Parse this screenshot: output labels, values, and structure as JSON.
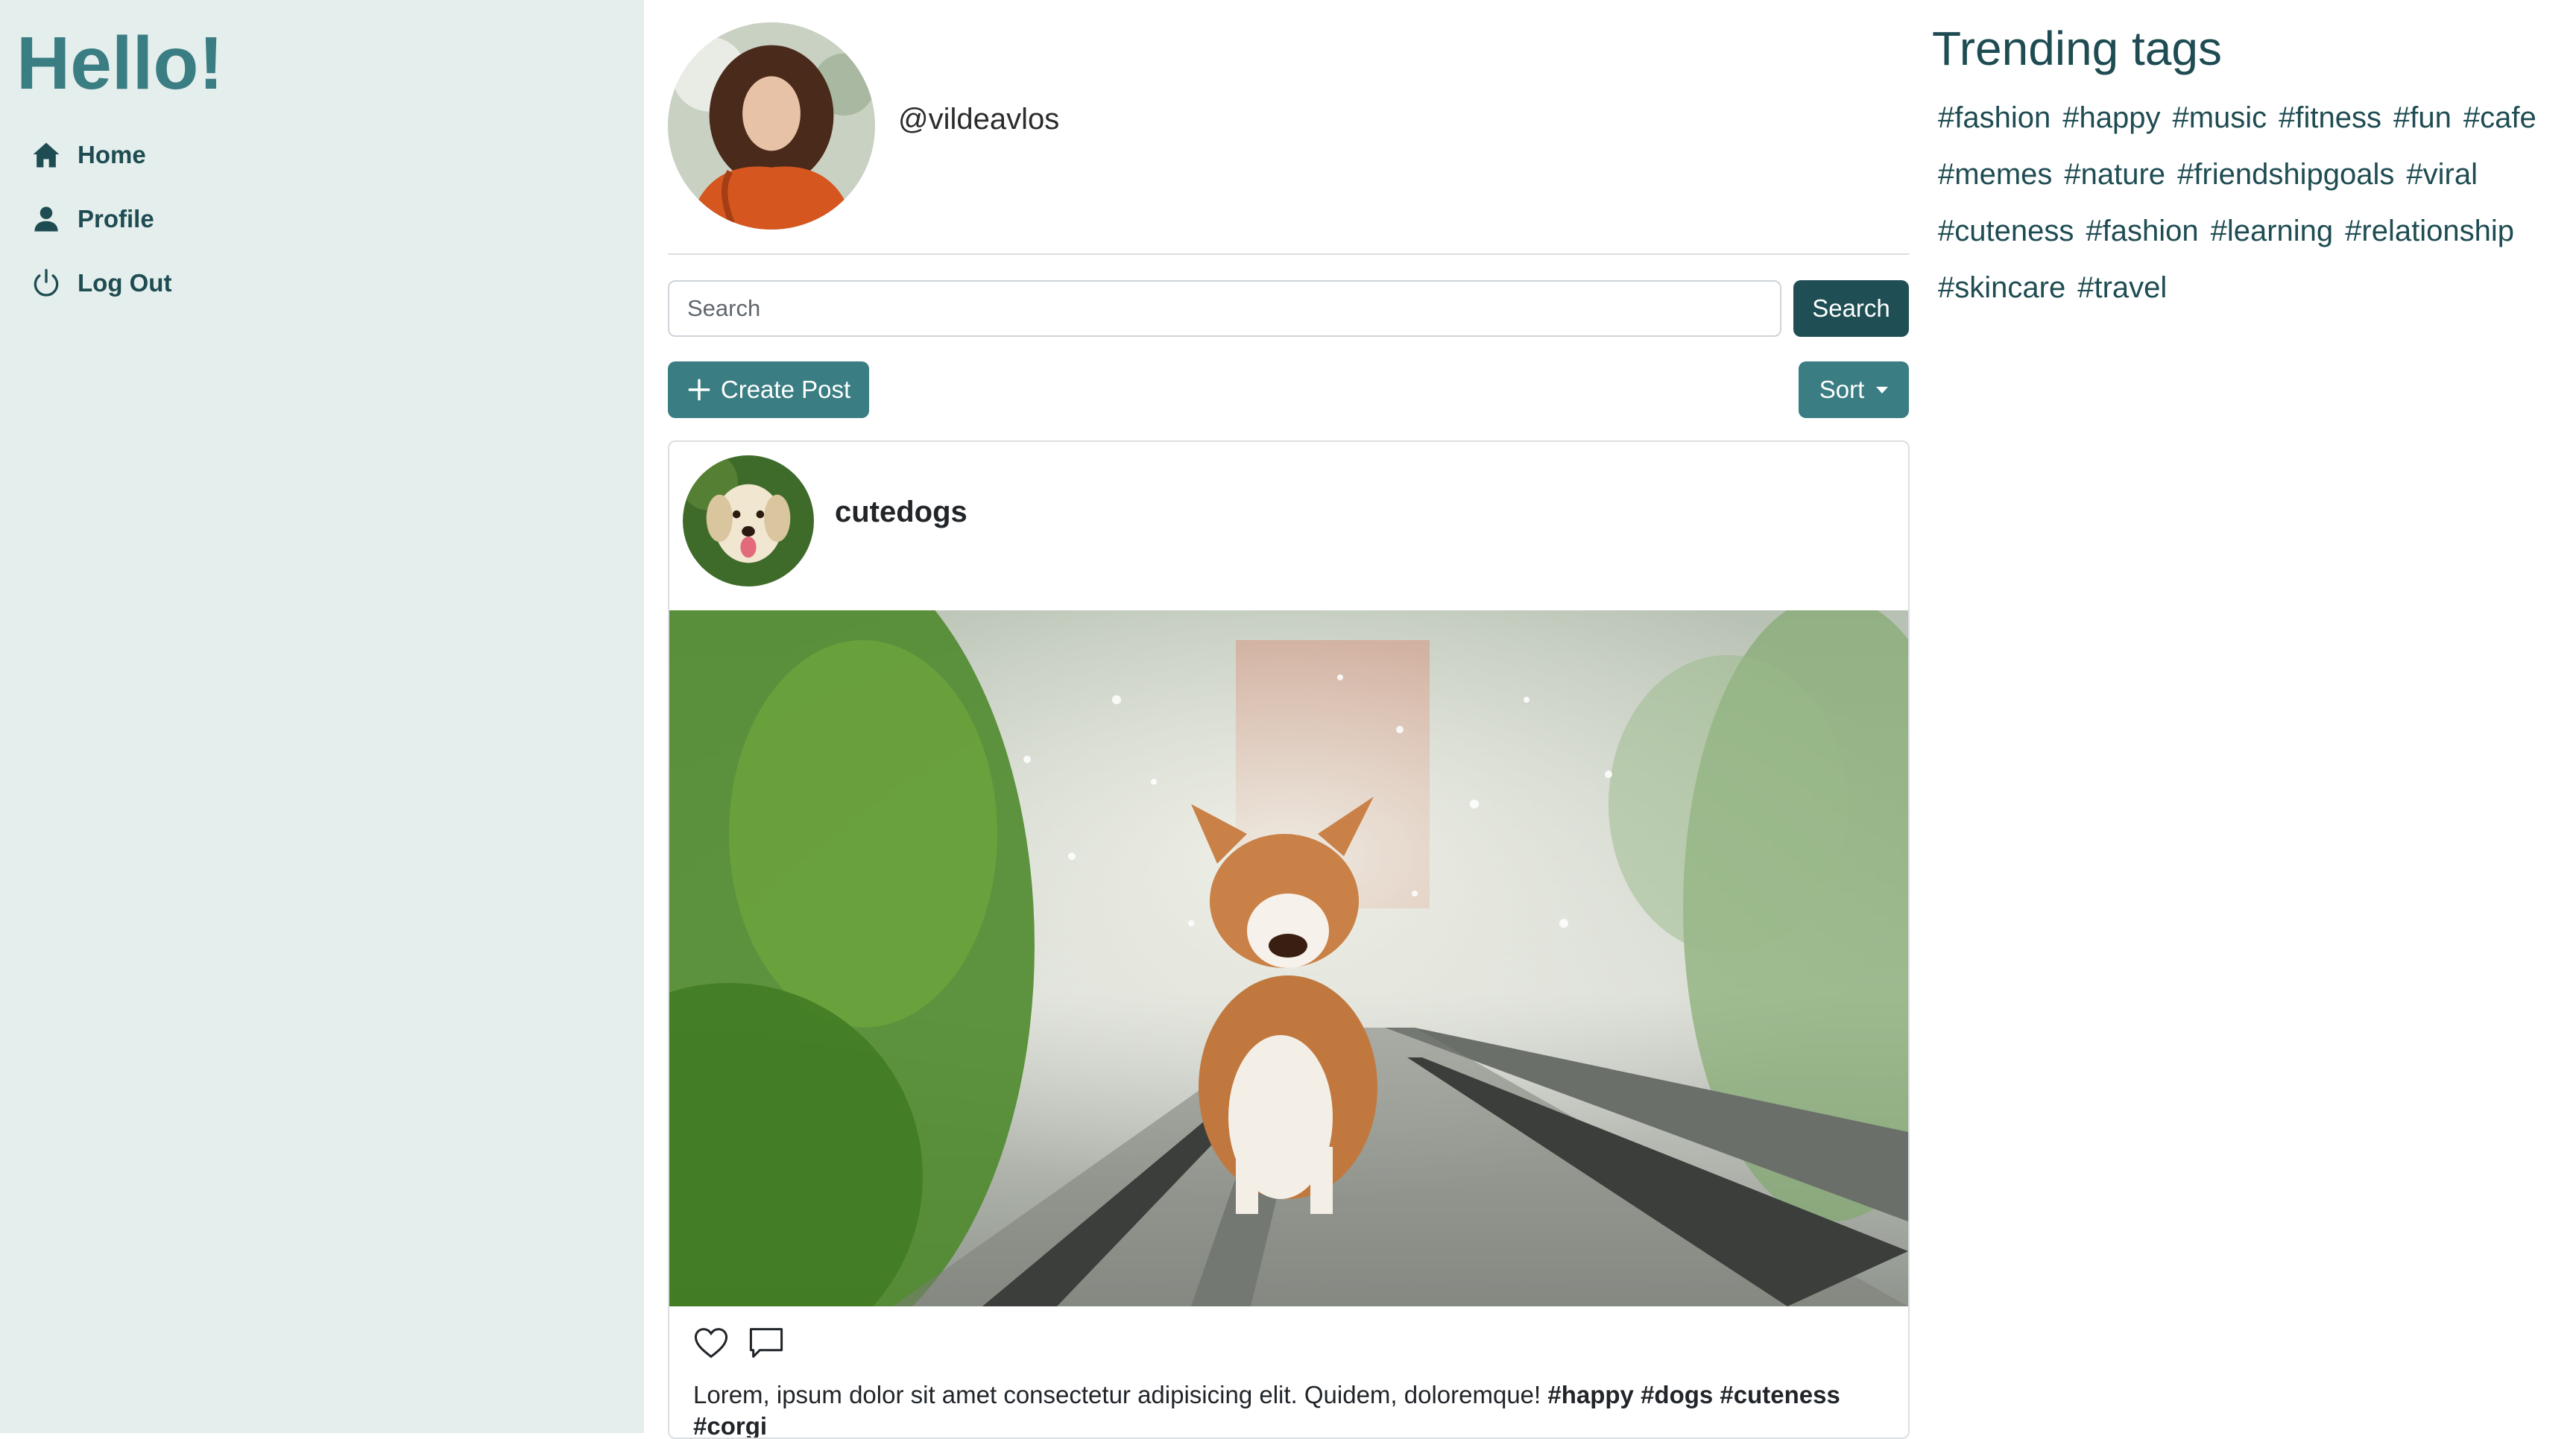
{
  "sidebar": {
    "brand": "Hello!",
    "items": [
      {
        "label": "Home",
        "icon": "home-icon"
      },
      {
        "label": "Profile",
        "icon": "person-icon"
      },
      {
        "label": "Log Out",
        "icon": "power-icon"
      }
    ]
  },
  "profile": {
    "handle": "@vildeavlos"
  },
  "search": {
    "placeholder": "Search",
    "button_label": "Search"
  },
  "toolbar": {
    "create_label": "Create Post",
    "sort_label": "Sort"
  },
  "post": {
    "username": "cutedogs",
    "caption": "Lorem, ipsum dolor sit amet consectetur adipisicing elit. Quidem, doloremque!",
    "hashtags": "#happy #dogs #cuteness #corgi"
  },
  "trending": {
    "title": "Trending tags",
    "tags": [
      "#fashion",
      "#happy",
      "#music",
      "#fitness",
      "#fun",
      "#cafe",
      "#memes",
      "#nature",
      "#friendshipgoals",
      "#viral",
      "#cuteness",
      "#fashion",
      "#learning",
      "#relationship",
      "#skincare",
      "#travel"
    ]
  },
  "colors": {
    "accent": "#3a7d83",
    "dark": "#1f4f55",
    "sidebar_bg": "#e4eeec"
  }
}
